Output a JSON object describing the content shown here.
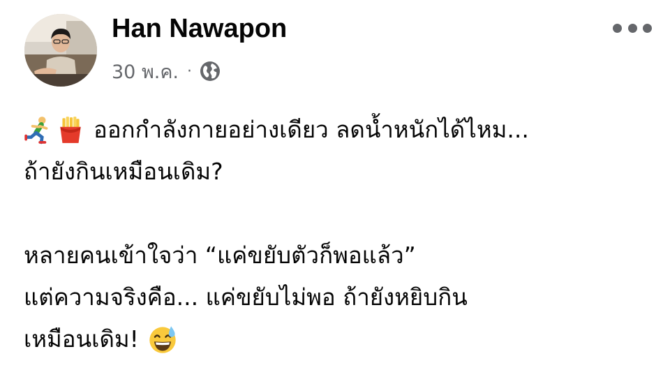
{
  "author": {
    "name": "Han Nawapon"
  },
  "meta": {
    "date": "30 พ.ค.",
    "separator": "·",
    "privacy_icon": "globe-icon"
  },
  "menu": {
    "icon": "more-options-icon"
  },
  "post": {
    "line1_icons": [
      "runner-emoji",
      "fries-emoji"
    ],
    "line1": "ออกกำลังกายอย่างเดียว ลดน้ำหนักได้ไหม...",
    "line2": "ถ้ายังกินเหมือนเดิม?",
    "line3": "หลายคนเข้าใจว่า “แค่ขยับตัวก็พอแล้ว”",
    "line4": "แต่ความจริงคือ... แค่ขยับไม่พอ ถ้ายังหยิบกิน",
    "line5": "เหมือนเดิม!",
    "line5_icon": "sweat-smile-emoji"
  },
  "colors": {
    "secondary_text": "#65676b",
    "primary_text": "#050505"
  }
}
